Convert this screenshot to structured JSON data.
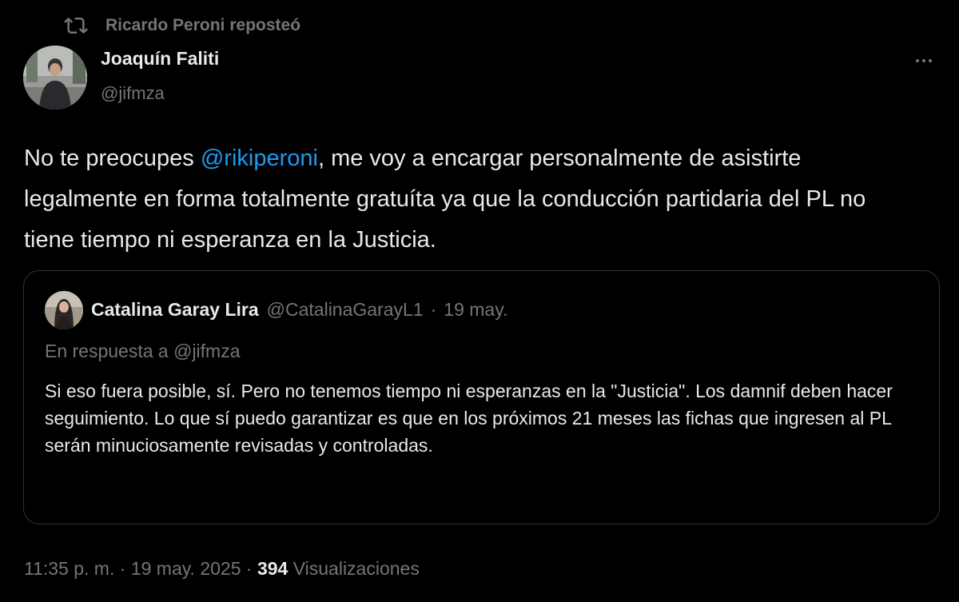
{
  "repost": {
    "icon": "repost-icon",
    "name": "Ricardo Peroni",
    "suffix": "reposteó"
  },
  "tweet": {
    "author_name": "Joaquín Faliti",
    "author_handle": "@jifmza",
    "text_before_mention": "No te preocupes ",
    "mention": "@rikiperoni",
    "text_after_mention": ", me voy a encargar personalmente de asistirte legalmente en forma totalmente gratuíta ya que la conducción partidaria del PL no tiene tiempo ni esperanza en la Justicia.",
    "time": "11:35 p. m.",
    "separator": "·",
    "date": "19 may. 2025",
    "views_count": "394",
    "views_label": "Visualizaciones"
  },
  "quote": {
    "name": "Catalina Garay Lira",
    "handle": "@CatalinaGarayL1",
    "separator": "·",
    "date": "19 may.",
    "reply_context": "En respuesta a @jifmza",
    "text": "Si eso fuera posible, sí. Pero no tenemos tiempo ni esperanzas en la \"Justicia\". Los damnif deben hacer seguimiento. Lo que sí puedo garantizar es que en los próximos 21 meses las fichas que ingresen al PL serán minuciosamente revisadas y controladas."
  },
  "colors": {
    "background": "#000000",
    "text_primary": "#e7e9ea",
    "text_secondary": "#71767b",
    "link": "#1d9bf0",
    "border": "#2f3336"
  }
}
